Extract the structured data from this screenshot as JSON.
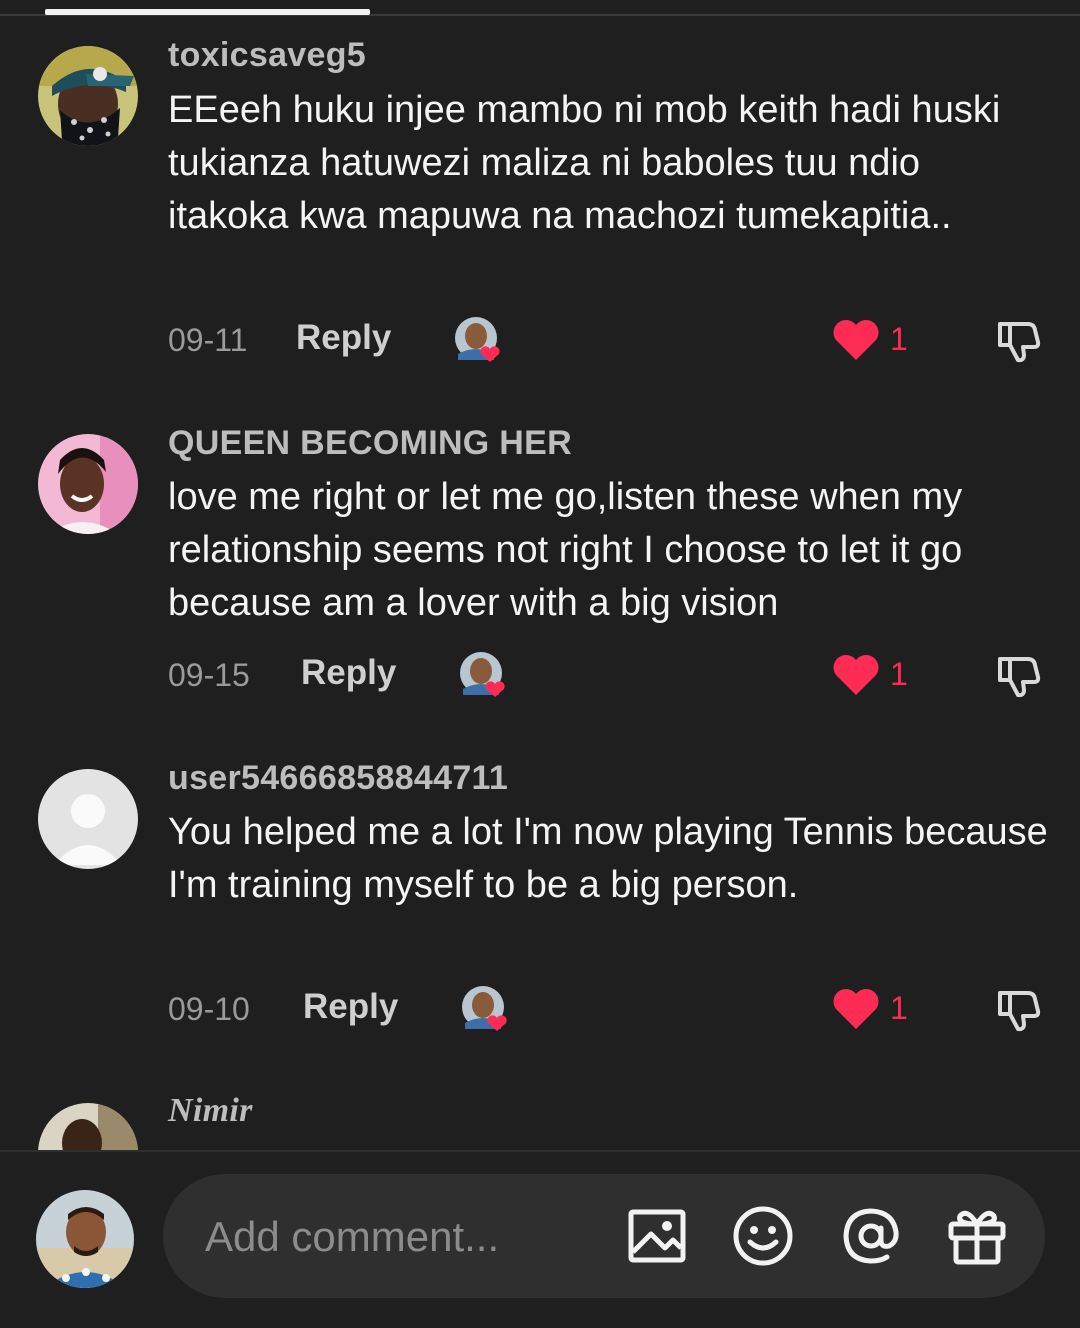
{
  "comments": [
    {
      "username": "toxicsaveg5",
      "text": "EEeeh huku injee mambo ni mob keith hadi huski tukianza hatuwezi maliza ni baboles tuu ndio itakoka kwa mapuwa na machozi tumekapitia..",
      "date": "09-11",
      "reply_label": "Reply",
      "likes": "1",
      "avatar_icon": "avatar-cap-bandana",
      "liked": true,
      "creator_liked": true
    },
    {
      "username": "QUEEN BECOMING HER",
      "text": "love me right or let me go,listen these when my relationship seems not right I choose to let it go because am a lover with a big vision",
      "date": "09-15",
      "reply_label": "Reply",
      "likes": "1",
      "avatar_icon": "avatar-woman-pink",
      "liked": true,
      "creator_liked": true
    },
    {
      "username": "user54666858844711",
      "text": "You helped me a lot I'm now playing Tennis because I'm training myself to be a big person.",
      "date": "09-10",
      "reply_label": "Reply",
      "likes": "1",
      "avatar_icon": "avatar-default",
      "liked": true,
      "creator_liked": true
    },
    {
      "username": "Nimir",
      "avatar_icon": "avatar-man-outdoor"
    }
  ],
  "composer": {
    "placeholder": "Add comment...",
    "icons": [
      "image-icon",
      "emoji-icon",
      "mention-icon",
      "gift-icon"
    ]
  },
  "colors": {
    "background": "#1f1f1f",
    "like_red": "#fe2c55",
    "username_gray": "#bdbdbd",
    "date_gray": "#9a9a9a",
    "input_bg": "#2f2f2f"
  }
}
